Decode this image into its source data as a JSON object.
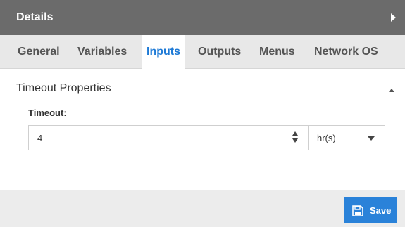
{
  "panel": {
    "title": "Details"
  },
  "tabs": [
    {
      "label": "General",
      "active": false
    },
    {
      "label": "Variables",
      "active": false
    },
    {
      "label": "Inputs",
      "active": true
    },
    {
      "label": "Outputs",
      "active": false
    },
    {
      "label": "Menus",
      "active": false
    },
    {
      "label": "Network OS",
      "active": false
    }
  ],
  "section": {
    "header": "Timeout Properties",
    "timeout_label": "Timeout:",
    "timeout_value": "4",
    "unit_value": "hr(s)"
  },
  "footer": {
    "save_label": "Save"
  },
  "colors": {
    "titlebar": "#6b6b6b",
    "accent": "#1e7ad6",
    "button": "#2a82d9"
  },
  "icons": {
    "expand": "chevron-right-icon",
    "collapse": "chevron-up-icon",
    "spinner": "spinner-arrows-icon",
    "dropdown": "chevron-down-icon",
    "save": "floppy-disk-icon"
  }
}
